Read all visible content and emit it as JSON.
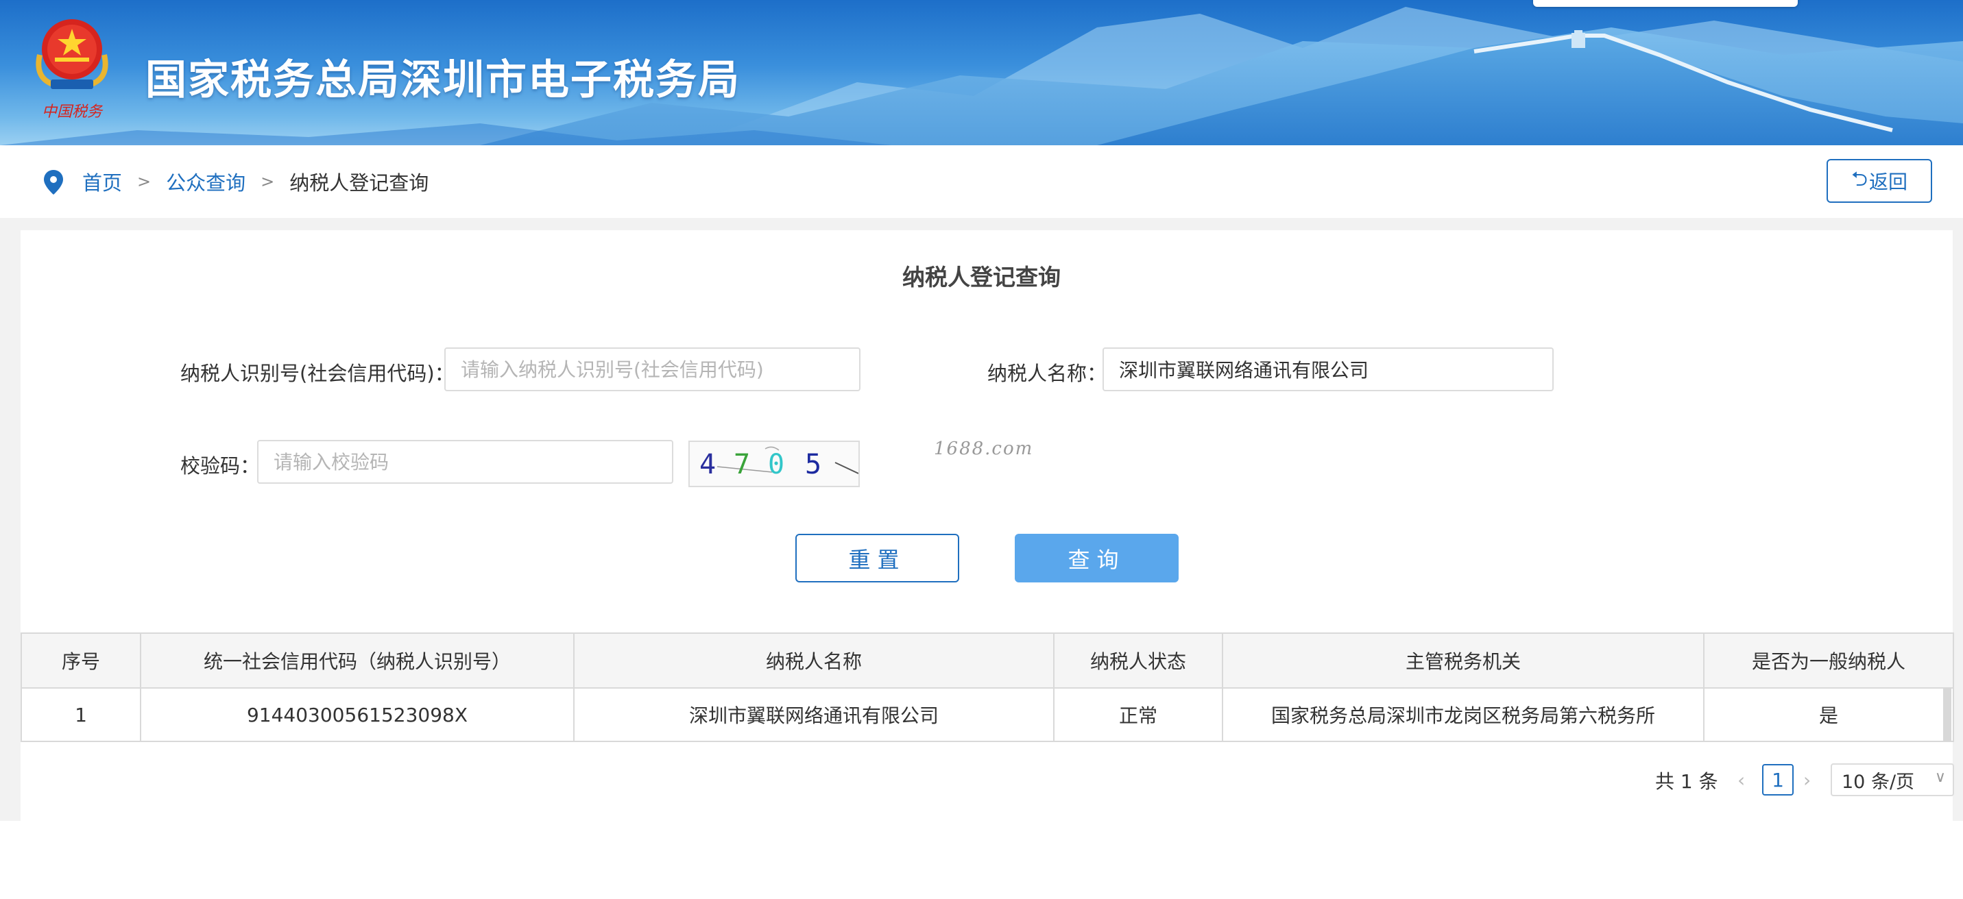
{
  "banner": {
    "site_title": "国家税务总局深圳市电子税务局",
    "logo_caption": "中国税务"
  },
  "breadcrumb": {
    "home": "首页",
    "public_query": "公众查询",
    "current": "纳税人登记查询",
    "separator": ">"
  },
  "back_button": {
    "label": "返回",
    "icon": "undo-arrow-icon"
  },
  "form": {
    "title": "纳税人登记查询",
    "taxpayer_id": {
      "label": "纳税人识别号(社会信用代码)：",
      "value": "",
      "placeholder": "请输入纳税人识别号(社会信用代码)"
    },
    "taxpayer_name": {
      "label": "纳税人名称：",
      "value": "深圳市翼联网络通讯有限公司",
      "placeholder": ""
    },
    "captcha": {
      "label": "校验码：",
      "value": "",
      "placeholder": "请输入校验码",
      "image_text": [
        "4",
        "7",
        "0",
        "5"
      ]
    },
    "watermark": "1688.com",
    "reset_label": "重置",
    "query_label": "查询"
  },
  "table": {
    "headers": [
      "序号",
      "统一社会信用代码（纳税人识别号）",
      "纳税人名称",
      "纳税人状态",
      "主管税务机关",
      "是否为一般纳税人"
    ],
    "rows": [
      [
        "1",
        "91440300561523098X",
        "深圳市翼联网络通讯有限公司",
        "正常",
        "国家税务总局深圳市龙岗区税务局第六税务所",
        "是"
      ]
    ]
  },
  "pagination": {
    "total": "共 1 条",
    "current_page": "1",
    "page_size": "10 条/页"
  },
  "colors": {
    "primary": "#1f6fbf",
    "query_button": "#5aa7ec",
    "banner_blue": "#3a8fdc"
  }
}
